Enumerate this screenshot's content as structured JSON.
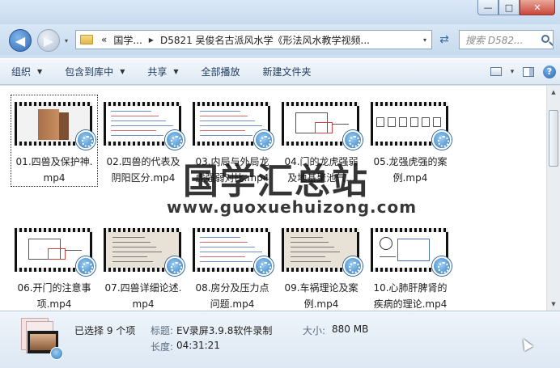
{
  "window": {
    "min_label": "—",
    "max_label": "□",
    "close_label": "✕"
  },
  "nav": {
    "back_label": "◀",
    "forward_label": "▶",
    "history_label": "▾",
    "address_segments": [
      "«",
      "国学...",
      "D5821 吴俊名古派风水学《形法风水教学视频..."
    ],
    "refresh_label": "⇄",
    "search_placeholder": "搜索 D582..."
  },
  "toolbar": {
    "items": [
      {
        "label": "组织",
        "caret": true
      },
      {
        "label": "包含到库中",
        "caret": true
      },
      {
        "label": "共享",
        "caret": true
      },
      {
        "label": "全部播放",
        "caret": false
      },
      {
        "label": "新建文件夹",
        "caret": false
      }
    ],
    "view_label": "▾",
    "help_label": "?"
  },
  "files": [
    {
      "line1": "01.四兽及保护神.",
      "line2": "mp4",
      "thumb": "building"
    },
    {
      "line1": "02.四兽的代表及",
      "line2": "阴阳区分.mp4",
      "thumb": "text"
    },
    {
      "line1": "03.内局与外局龙",
      "line2": "虎强弱对比.mp4",
      "thumb": "text"
    },
    {
      "line1": "04.门的龙虎强弱",
      "line2": "及地基聚池气...",
      "thumb": "diagram"
    },
    {
      "line1": "05.龙强虎强的案",
      "line2": "例.mp4",
      "thumb": "row"
    },
    {
      "line1": "06.开门的注意事",
      "line2": "项.mp4",
      "thumb": "diagram"
    },
    {
      "line1": "07.四兽详细论述.",
      "line2": "mp4",
      "thumb": "paper"
    },
    {
      "line1": "08.房分及压力点",
      "line2": "问题.mp4",
      "thumb": "text"
    },
    {
      "line1": "09.车祸理论及案",
      "line2": "例.mp4",
      "thumb": "paper"
    },
    {
      "line1": "10.心肺肝脾肾的",
      "line2": "疾病的理论.mp4",
      "thumb": "chart"
    }
  ],
  "watermark": {
    "cn": "国学汇总站",
    "url": "www.guoxuehuizong.com"
  },
  "scrollbar": {
    "up_label": "▲",
    "down_label": "▼"
  },
  "details": {
    "selected": "已选择 9 个项",
    "title_label": "标题:",
    "title_value": "EV录屏3.9.8软件录制",
    "size_label": "大小:",
    "size_value": "880 MB",
    "length_label": "长度:",
    "length_value": "04:31:21"
  },
  "colors": {
    "accent": "#2e77b8",
    "frame_bg": "#cfe0f1"
  }
}
